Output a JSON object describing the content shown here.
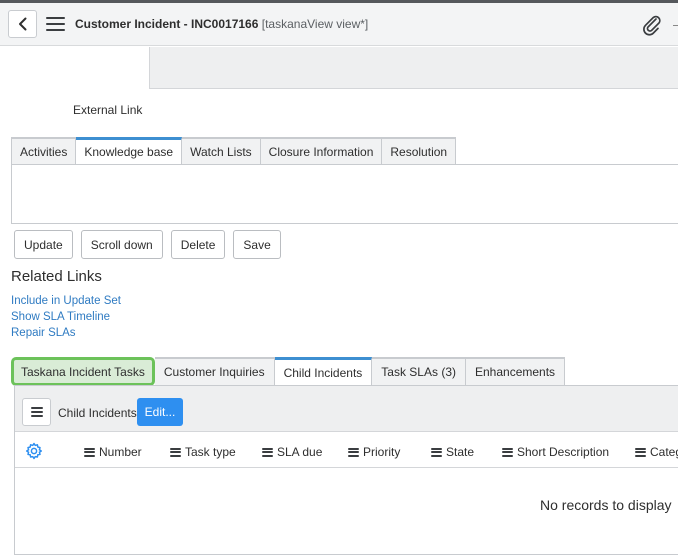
{
  "header": {
    "title": "Customer Incident - INC0017166",
    "view": "[taskanaView view*]"
  },
  "form": {
    "external_link_label": "External Link"
  },
  "form_tabs": [
    {
      "label": "Activities",
      "active": false
    },
    {
      "label": "Knowledge base",
      "active": true
    },
    {
      "label": "Watch Lists",
      "active": false
    },
    {
      "label": "Closure Information",
      "active": false
    },
    {
      "label": "Resolution",
      "active": false
    }
  ],
  "buttons": {
    "update": "Update",
    "scroll_down": "Scroll down",
    "delete": "Delete",
    "save": "Save"
  },
  "related_links": {
    "heading": "Related Links",
    "links": [
      "Include in Update Set",
      "Show SLA Timeline",
      "Repair SLAs"
    ]
  },
  "related_tabs": [
    {
      "label": "Taskana Incident Tasks",
      "highlighted": true
    },
    {
      "label": "Customer Inquiries"
    },
    {
      "label": "Child Incidents",
      "active": true
    },
    {
      "label": "Task SLAs (3)"
    },
    {
      "label": "Enhancements"
    }
  ],
  "list": {
    "title": "Child Incidents",
    "edit_label": "Edit...",
    "columns": [
      "Number",
      "Task type",
      "SLA due",
      "Priority",
      "State",
      "Short Description",
      "Catego"
    ],
    "empty_message": "No records to display"
  },
  "colors": {
    "accent": "#2e8ff0",
    "tab_active_border": "#3d8fd1",
    "highlight_border": "#6cc25a",
    "link": "#2f7bc2"
  },
  "icons": {
    "back": "chevron-left-icon",
    "menu": "hamburger-icon",
    "attach": "paperclip-icon",
    "settings": "gear-icon"
  }
}
